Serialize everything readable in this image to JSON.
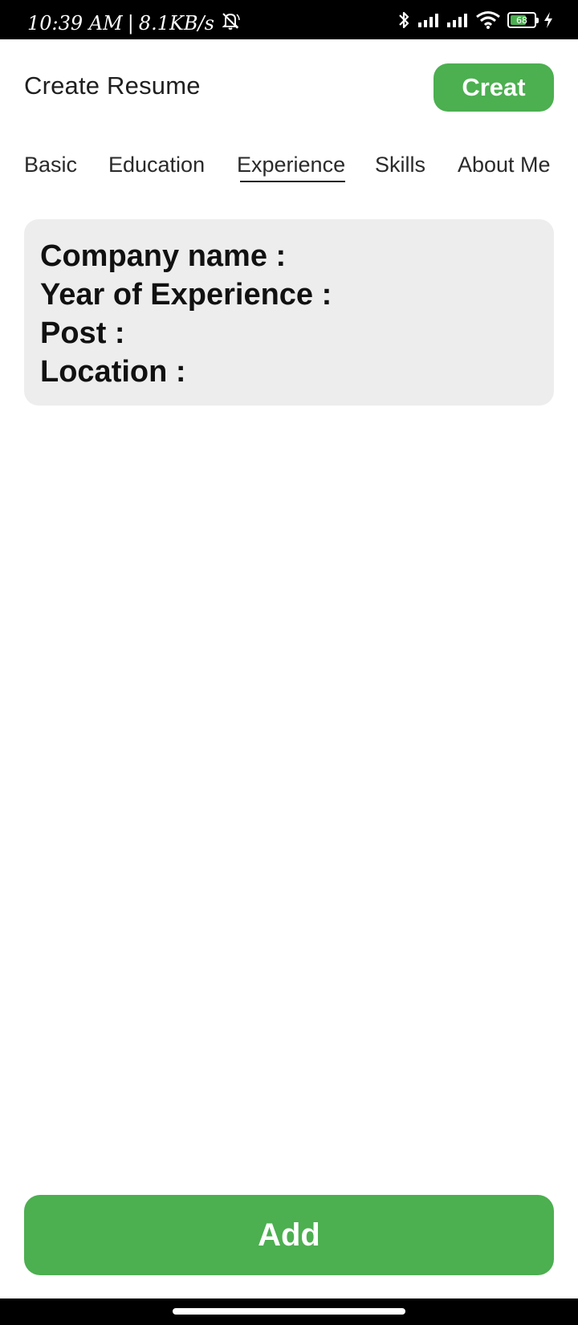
{
  "status_bar": {
    "time": "10:39 AM",
    "separator": "|",
    "net_speed": "8.1KB/s",
    "icons": [
      "muted-bell-icon",
      "bluetooth-icon",
      "signal-icon",
      "signal-icon",
      "wifi-icon",
      "battery-icon",
      "charging-icon"
    ],
    "battery_level": "68",
    "battery_fraction": 0.68,
    "battery_color": "#4caf50"
  },
  "header": {
    "title": "Create Resume",
    "create_label": "Creat"
  },
  "tabs": [
    {
      "label": "Basic",
      "active": false
    },
    {
      "label": "Education",
      "active": false
    },
    {
      "label": "Experience",
      "active": true
    },
    {
      "label": "Skills",
      "active": false
    },
    {
      "label": "About Me",
      "active": false
    }
  ],
  "experience_card": {
    "company_label": "Company name :",
    "years_label": "Year of Experience :",
    "post_label": "Post :",
    "location_label": "Location :"
  },
  "footer": {
    "add_label": "Add"
  },
  "colors": {
    "accent": "#4caf50",
    "card_background": "#ededed",
    "system_bars": "#000000"
  }
}
